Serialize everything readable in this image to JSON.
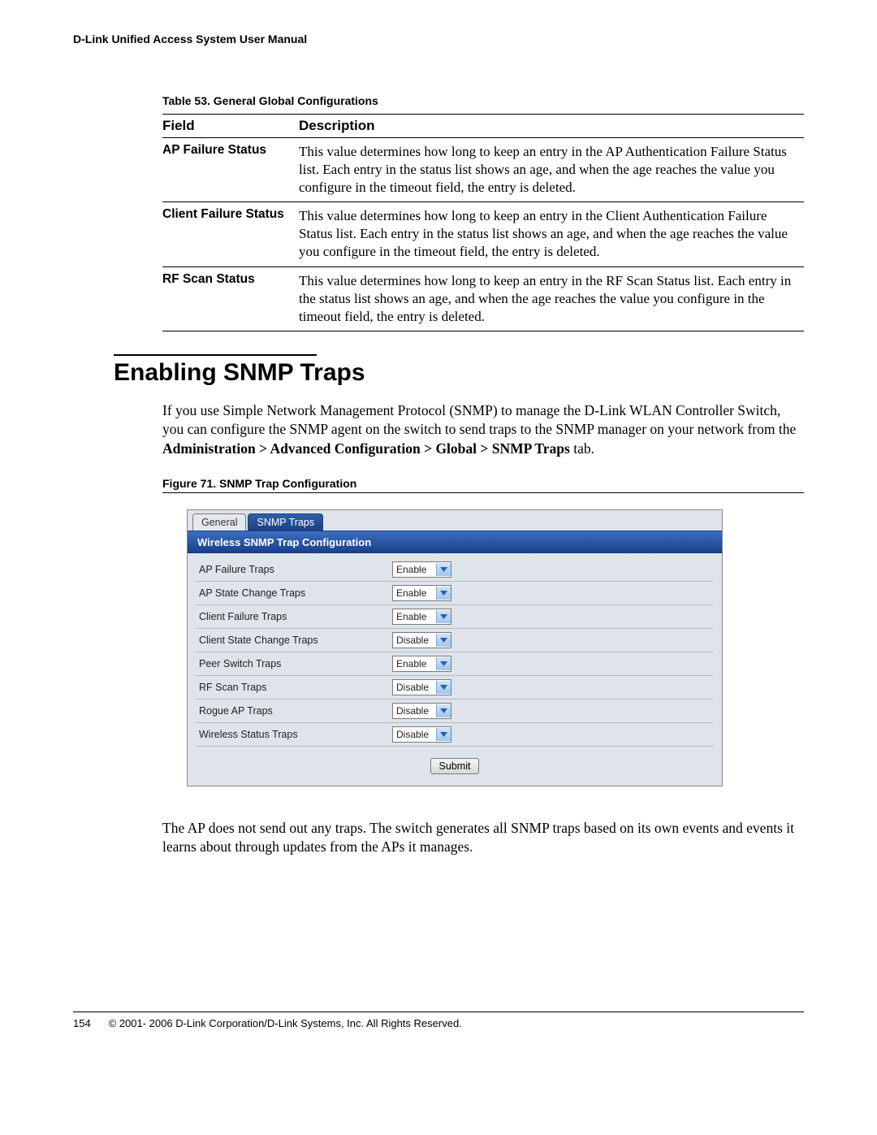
{
  "header": {
    "title": "D-Link Unified Access System User Manual"
  },
  "config_table": {
    "caption_num": "Table 53.",
    "caption_title": "General Global Configurations",
    "col_field": "Field",
    "col_desc": "Description",
    "rows": [
      {
        "field": "AP Failure Status",
        "desc": "This value determines how long to keep an entry in the AP Authentication Failure Status list. Each entry in the status list shows an age, and when the age reaches the value you configure in the timeout field, the entry is deleted."
      },
      {
        "field": "Client Failure Status",
        "desc": "This value determines how long to keep an entry in the Client Authentication Failure Status list. Each entry in the status list shows an age, and when the age reaches the value you configure in the timeout field, the entry is deleted."
      },
      {
        "field": "RF Scan Status",
        "desc": "This value determines how long to keep an entry in the RF Scan Status list. Each entry in the status list shows an age, and when the age reaches the value you configure in the timeout field, the entry is deleted."
      }
    ]
  },
  "section": {
    "heading": "Enabling SNMP Traps"
  },
  "intro": {
    "pre": "If you use Simple Network Management Protocol (SNMP) to manage the D-Link WLAN Controller Switch, you can configure the SNMP agent on the switch to send traps to the SNMP manager on your network from the ",
    "bold": "Administration > Advanced Configuration > Global > SNMP Traps",
    "post": " tab."
  },
  "figure": {
    "caption": "Figure 71.  SNMP Trap Configuration"
  },
  "ui": {
    "tabs": {
      "general": "General",
      "snmp": "SNMP Traps"
    },
    "panel_title": "Wireless SNMP Trap Configuration",
    "rows": [
      {
        "label": "AP Failure Traps",
        "value": "Enable"
      },
      {
        "label": "AP State Change Traps",
        "value": "Enable"
      },
      {
        "label": "Client Failure Traps",
        "value": "Enable"
      },
      {
        "label": "Client State Change Traps",
        "value": "Disable"
      },
      {
        "label": "Peer Switch Traps",
        "value": "Enable"
      },
      {
        "label": "RF Scan Traps",
        "value": "Disable"
      },
      {
        "label": "Rogue AP Traps",
        "value": "Disable"
      },
      {
        "label": "Wireless Status Traps",
        "value": "Disable"
      }
    ],
    "submit": "Submit"
  },
  "outro": "The AP does not send out any traps. The switch generates all SNMP traps based on its own events and events it learns about through updates from the APs it manages.",
  "footer": {
    "page": "154",
    "text": "© 2001- 2006 D-Link Corporation/D-Link Systems, Inc. All Rights Reserved."
  }
}
